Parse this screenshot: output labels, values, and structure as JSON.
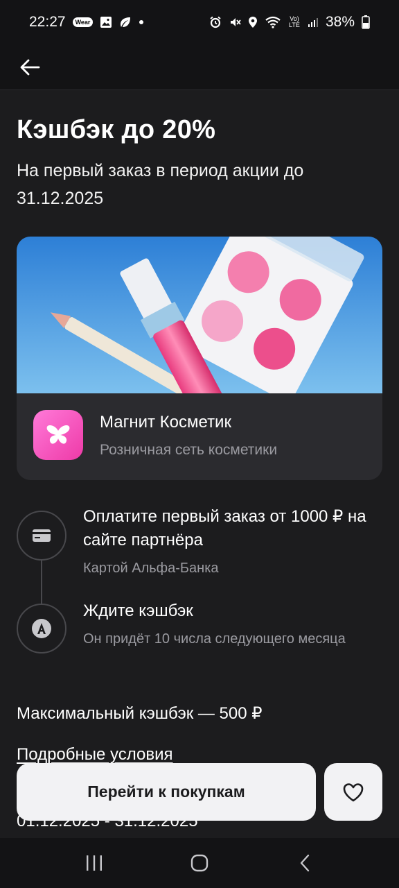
{
  "status_bar": {
    "time": "22:27",
    "wear_label": "Wear",
    "battery": "38%",
    "volte_label": "Vo) LTE"
  },
  "header": {
    "back_icon": "arrow-left-icon"
  },
  "promo": {
    "title": "Кэшбэк до 20%",
    "subtitle": "На первый заказ в период акции до 31.12.2025"
  },
  "partner": {
    "name": "Магнит Косметик",
    "description": "Розничная сеть косметики",
    "logo_icon": "butterfly-icon",
    "logo_color": "#f04fb6"
  },
  "steps": [
    {
      "icon": "card-icon",
      "main": "Оплатите первый заказ от 1000 ₽ на сайте партнёра",
      "sub": "Картой Альфа-Банка"
    },
    {
      "icon": "alfa-logo-icon",
      "main": "Ждите кэшбэк",
      "sub": "Он придёт 10 числа следующего месяца"
    }
  ],
  "max_cashback": "Максимальный кэшбэк — 500 ₽",
  "details_link": "Подробные условия",
  "dates": "01.12.2025 - 31.12.2025",
  "actions": {
    "go_label": "Перейти к покупкам",
    "fav_icon": "heart-icon"
  },
  "nav_bar": {
    "recents_icon": "recents-icon",
    "home_icon": "home-icon",
    "back_icon": "back-chevron-icon"
  }
}
